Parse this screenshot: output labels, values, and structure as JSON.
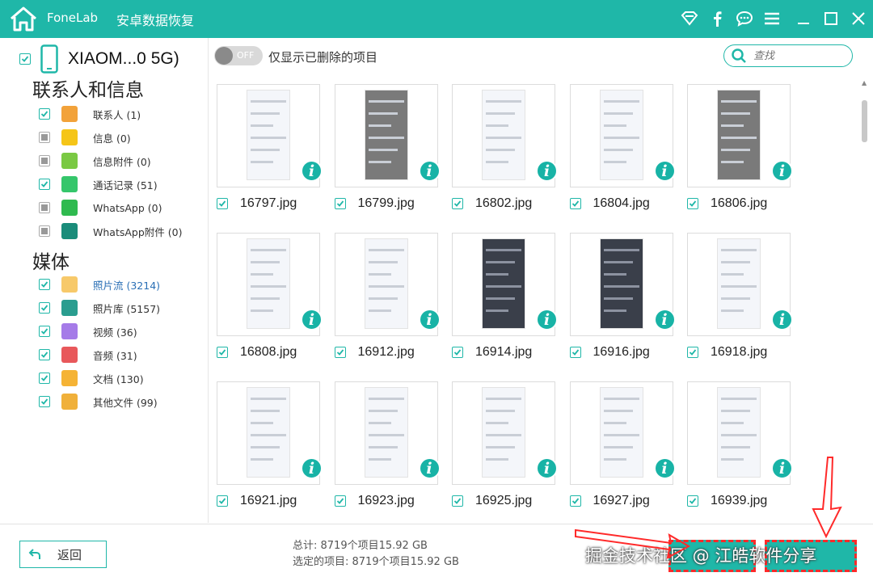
{
  "titlebar": {
    "brand": "FoneLab",
    "title": "安卓数据恢复"
  },
  "device": {
    "name": "XIAOM...0 5G)"
  },
  "sections": {
    "contacts_title": "联系人和信息",
    "media_title": "媒体"
  },
  "categories": [
    {
      "label": "联系人 (1)",
      "icon": "contacts-icon",
      "color": "#f2a23a",
      "checked": true
    },
    {
      "label": "信息 (0)",
      "icon": "message-icon",
      "color": "#f5c518",
      "checked": false
    },
    {
      "label": "信息附件 (0)",
      "icon": "attachment-icon",
      "color": "#7ac943",
      "checked": false
    },
    {
      "label": "通话记录 (51)",
      "icon": "phone-icon",
      "color": "#35c66b",
      "checked": true
    },
    {
      "label": "WhatsApp (0)",
      "icon": "whatsapp-icon",
      "color": "#2fba4f",
      "checked": false
    },
    {
      "label": "WhatsApp附件 (0)",
      "icon": "whatsapp-attachment-icon",
      "color": "#1a8c7a",
      "checked": false
    }
  ],
  "media": [
    {
      "label": "照片流 (3214)",
      "icon": "photostream-icon",
      "color": "#f7c96a",
      "checked": true,
      "active": true
    },
    {
      "label": "照片库 (5157)",
      "icon": "photo-library-icon",
      "color": "#2a9d8f",
      "checked": true
    },
    {
      "label": "视频 (36)",
      "icon": "video-icon",
      "color": "#a57be8",
      "checked": true
    },
    {
      "label": "音频 (31)",
      "icon": "audio-icon",
      "color": "#e8585b",
      "checked": true
    },
    {
      "label": "文档 (130)",
      "icon": "document-icon",
      "color": "#f5b335",
      "checked": true
    },
    {
      "label": "其他文件 (99)",
      "icon": "other-files-icon",
      "color": "#f0b03a",
      "checked": true
    }
  ],
  "toolbar": {
    "toggle_text": "OFF",
    "toggle_label": "仅显示已删除的项目",
    "search_placeholder": "查找"
  },
  "files": [
    {
      "name": "16797.jpg",
      "style": "light"
    },
    {
      "name": "16799.jpg",
      "style": "grey"
    },
    {
      "name": "16802.jpg",
      "style": "light"
    },
    {
      "name": "16804.jpg",
      "style": "light"
    },
    {
      "name": "16806.jpg",
      "style": "grey"
    },
    {
      "name": "16808.jpg",
      "style": "light"
    },
    {
      "name": "16912.jpg",
      "style": "light"
    },
    {
      "name": "16914.jpg",
      "style": "dark"
    },
    {
      "name": "16916.jpg",
      "style": "dark"
    },
    {
      "name": "16918.jpg",
      "style": "light"
    },
    {
      "name": "16921.jpg",
      "style": "light"
    },
    {
      "name": "16923.jpg",
      "style": "light"
    },
    {
      "name": "16925.jpg",
      "style": "light"
    },
    {
      "name": "16927.jpg",
      "style": "light"
    },
    {
      "name": "16939.jpg",
      "style": "light"
    }
  ],
  "footer": {
    "back_label": "返回",
    "total": "总计: 8719个项目15.92 GB",
    "selected": "选定的项目: 8719个项目15.92 GB"
  },
  "watermark": "掘金技术社区 @ 江皓软件分享",
  "colors": {
    "accent": "#1fb7a8",
    "annotation": "#ff2a2a"
  }
}
